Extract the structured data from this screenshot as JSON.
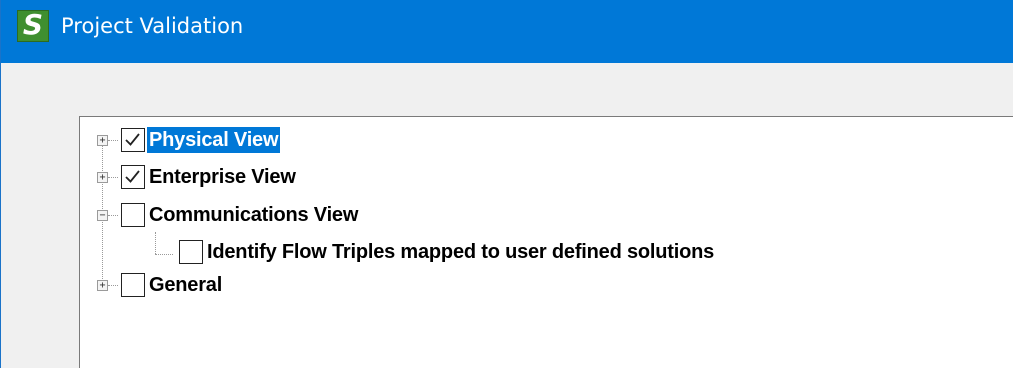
{
  "window": {
    "title": "Project Validation",
    "app_icon": "app-s-icon",
    "app_icon_glyph": "S"
  },
  "tree": {
    "nodes": [
      {
        "label": "Physical View",
        "checked": true,
        "expanded": false,
        "selected": true,
        "level": 0
      },
      {
        "label": "Enterprise View",
        "checked": true,
        "expanded": false,
        "selected": false,
        "level": 0
      },
      {
        "label": "Communications View",
        "checked": false,
        "expanded": true,
        "selected": false,
        "level": 0
      },
      {
        "label": "Identify Flow Triples mapped to user defined solutions",
        "checked": false,
        "expanded": null,
        "selected": false,
        "level": 1
      },
      {
        "label": "General",
        "checked": false,
        "expanded": false,
        "selected": false,
        "level": 0
      }
    ],
    "expand_glyph": "+",
    "collapse_glyph": "−"
  },
  "colors": {
    "titlebar": "#0078d7",
    "selection": "#0078d7",
    "icon_green": "#3f8f2f"
  }
}
